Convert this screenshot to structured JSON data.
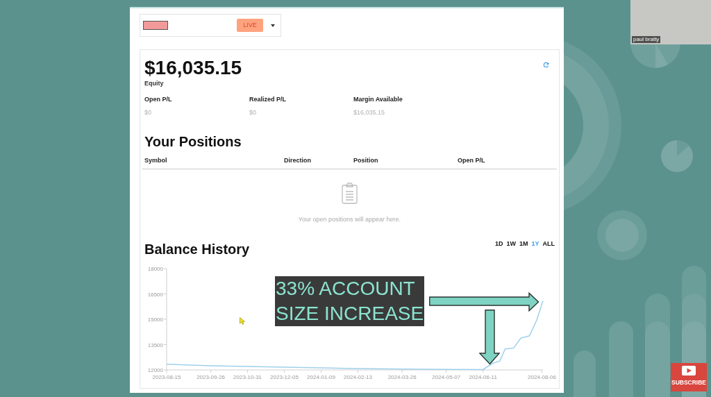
{
  "account_selector": {
    "badge": "LIVE"
  },
  "summary": {
    "equity": "$16,035.15",
    "equity_label": "Equity",
    "stats": [
      {
        "label": "Open P/L",
        "value": "$0"
      },
      {
        "label": "Realized P/L",
        "value": "$0"
      },
      {
        "label": "Margin Available",
        "value": "$16,035.15"
      }
    ]
  },
  "positions": {
    "title": "Your Positions",
    "columns": [
      "Symbol",
      "Direction",
      "Position",
      "Open P/L"
    ],
    "empty_message": "Your open positions will appear here."
  },
  "balance_history": {
    "title": "Balance History",
    "ranges": [
      {
        "label": "1D",
        "selected": false
      },
      {
        "label": "1W",
        "selected": false
      },
      {
        "label": "1M",
        "selected": false
      },
      {
        "label": "1Y",
        "selected": true
      },
      {
        "label": "ALL",
        "selected": false
      }
    ],
    "chart_data": {
      "type": "line",
      "x": [
        "2023-08-15",
        "2023-09-26",
        "2023-10-31",
        "2023-12-05",
        "2024-01-09",
        "2024-02-13",
        "2024-03-26",
        "2024-05-07",
        "2024-06-11",
        "2024-06-20",
        "2024-06-27",
        "2024-07-02",
        "2024-07-10",
        "2024-07-17",
        "2024-07-25",
        "2024-08-01",
        "2024-08-07"
      ],
      "values": [
        12340,
        12250,
        12210,
        12160,
        12120,
        12080,
        12050,
        12030,
        12020,
        12390,
        12530,
        13240,
        13290,
        13890,
        14010,
        14940,
        16100
      ],
      "xlim": [
        "2023-08-15",
        "2024-08-07"
      ],
      "ylim": [
        12000,
        18000
      ],
      "xticks": [
        "2023-08-15",
        "2023-09-26",
        "2023-10-31",
        "2023-12-05",
        "2024-01-09",
        "2024-02-13",
        "2024-03-26",
        "2024-05-07",
        "2024-06-11",
        "2024-08-06"
      ],
      "yticks": [
        12000,
        13500,
        15000,
        16500,
        18000
      ]
    }
  },
  "video_overlay": {
    "caption_lines": [
      "33% ACCOUNT",
      "SIZE INCREASE"
    ]
  },
  "webcam": {
    "name_tag": "paul bratty"
  },
  "subscribe_badge": {
    "label": "SUBSCRIBE"
  }
}
